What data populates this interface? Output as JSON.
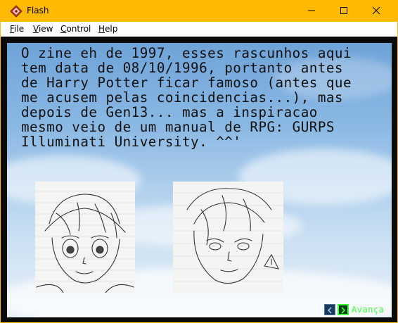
{
  "window": {
    "title": "Flash"
  },
  "menu": {
    "file": {
      "label": "File",
      "accel": "F",
      "rest": "ile"
    },
    "view": {
      "label": "View",
      "accel": "V",
      "rest": "iew"
    },
    "control": {
      "label": "Control",
      "accel": "C",
      "rest": "ontrol"
    },
    "help": {
      "label": "Help",
      "accel": "H",
      "rest": "elp"
    }
  },
  "stage": {
    "text": "O zine eh de 1997, esses rascunhos aqui\ntem data de 08/10/1996, portanto antes\nde Harry Potter ficar famoso (antes que\nme acusem pelas coincidencias...), mas\ndepois de Gen13... mas a inspiracao\nmesmo veio de um manual de RPG: GURPS\nIlluminati University. ^^'"
  },
  "navigation": {
    "next_label": "Avança"
  },
  "colors": {
    "titlebar": "#ffb900",
    "nav_accent": "#3cff3c"
  },
  "icons": {
    "app": "flash-player-icon",
    "minimize": "minimize-icon",
    "maximize": "maximize-icon",
    "close": "close-icon",
    "back": "chevron-left-icon",
    "next": "chevron-right-icon"
  }
}
